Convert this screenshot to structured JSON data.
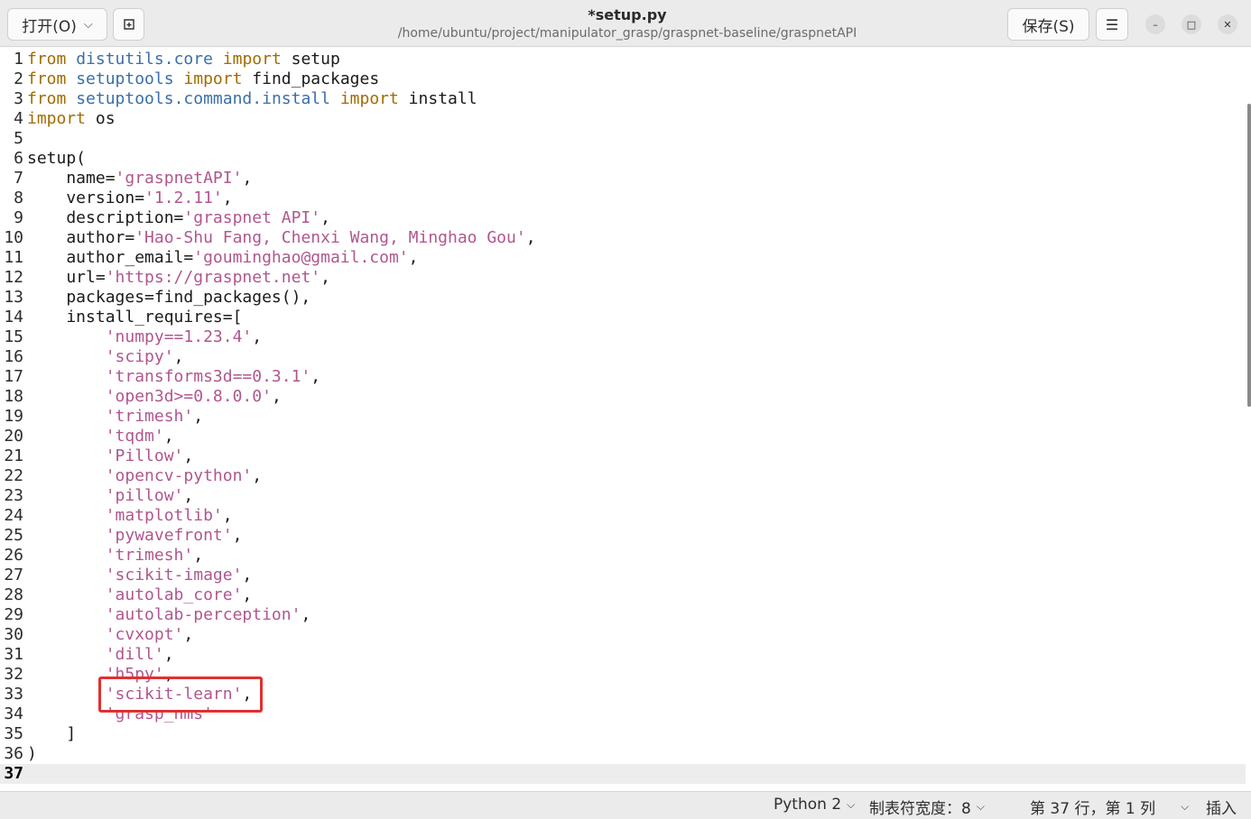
{
  "header": {
    "open_label": "打开(O)",
    "title": "*setup.py",
    "path": "/home/ubuntu/project/manipulator_grasp/graspnet-baseline/graspnetAPI",
    "save_label": "保存(S)"
  },
  "editor": {
    "current_line": 37,
    "lines": [
      {
        "n": "1",
        "tokens": [
          [
            "kw",
            "from"
          ],
          [
            "p",
            " "
          ],
          [
            "mod",
            "distutils.core"
          ],
          [
            "p",
            " "
          ],
          [
            "kw",
            "import"
          ],
          [
            "p",
            " setup"
          ]
        ]
      },
      {
        "n": "2",
        "tokens": [
          [
            "kw",
            "from"
          ],
          [
            "p",
            " "
          ],
          [
            "mod",
            "setuptools"
          ],
          [
            "p",
            " "
          ],
          [
            "kw",
            "import"
          ],
          [
            "p",
            " find_packages"
          ]
        ]
      },
      {
        "n": "3",
        "tokens": [
          [
            "kw",
            "from"
          ],
          [
            "p",
            " "
          ],
          [
            "mod",
            "setuptools.command.install"
          ],
          [
            "p",
            " "
          ],
          [
            "kw",
            "import"
          ],
          [
            "p",
            " install"
          ]
        ]
      },
      {
        "n": "4",
        "tokens": [
          [
            "kw",
            "import"
          ],
          [
            "p",
            " os"
          ]
        ]
      },
      {
        "n": "5",
        "tokens": []
      },
      {
        "n": "6",
        "tokens": [
          [
            "p",
            "setup("
          ]
        ]
      },
      {
        "n": "7",
        "tokens": [
          [
            "p",
            "    name="
          ],
          [
            "str",
            "'graspnetAPI'"
          ],
          [
            "p",
            ","
          ]
        ]
      },
      {
        "n": "8",
        "tokens": [
          [
            "p",
            "    version="
          ],
          [
            "str",
            "'1.2.11'"
          ],
          [
            "p",
            ","
          ]
        ]
      },
      {
        "n": "9",
        "tokens": [
          [
            "p",
            "    description="
          ],
          [
            "str",
            "'graspnet API'"
          ],
          [
            "p",
            ","
          ]
        ]
      },
      {
        "n": "10",
        "tokens": [
          [
            "p",
            "    author="
          ],
          [
            "str",
            "'Hao-Shu Fang, Chenxi Wang, Minghao Gou'"
          ],
          [
            "p",
            ","
          ]
        ]
      },
      {
        "n": "11",
        "tokens": [
          [
            "p",
            "    author_email="
          ],
          [
            "str",
            "'gouminghao@gmail.com'"
          ],
          [
            "p",
            ","
          ]
        ]
      },
      {
        "n": "12",
        "tokens": [
          [
            "p",
            "    url="
          ],
          [
            "str",
            "'https://graspnet.net'"
          ],
          [
            "p",
            ","
          ]
        ]
      },
      {
        "n": "13",
        "tokens": [
          [
            "p",
            "    packages=find_packages(),"
          ]
        ]
      },
      {
        "n": "14",
        "tokens": [
          [
            "p",
            "    install_requires=["
          ]
        ]
      },
      {
        "n": "15",
        "tokens": [
          [
            "p",
            "        "
          ],
          [
            "str",
            "'numpy==1.23.4'"
          ],
          [
            "p",
            ","
          ]
        ]
      },
      {
        "n": "16",
        "tokens": [
          [
            "p",
            "        "
          ],
          [
            "str",
            "'scipy'"
          ],
          [
            "p",
            ","
          ]
        ]
      },
      {
        "n": "17",
        "tokens": [
          [
            "p",
            "        "
          ],
          [
            "str",
            "'transforms3d==0.3.1'"
          ],
          [
            "p",
            ","
          ]
        ]
      },
      {
        "n": "18",
        "tokens": [
          [
            "p",
            "        "
          ],
          [
            "str",
            "'open3d>=0.8.0.0'"
          ],
          [
            "p",
            ","
          ]
        ]
      },
      {
        "n": "19",
        "tokens": [
          [
            "p",
            "        "
          ],
          [
            "str",
            "'trimesh'"
          ],
          [
            "p",
            ","
          ]
        ]
      },
      {
        "n": "20",
        "tokens": [
          [
            "p",
            "        "
          ],
          [
            "str",
            "'tqdm'"
          ],
          [
            "p",
            ","
          ]
        ]
      },
      {
        "n": "21",
        "tokens": [
          [
            "p",
            "        "
          ],
          [
            "str",
            "'Pillow'"
          ],
          [
            "p",
            ","
          ]
        ]
      },
      {
        "n": "22",
        "tokens": [
          [
            "p",
            "        "
          ],
          [
            "str",
            "'opencv-python'"
          ],
          [
            "p",
            ","
          ]
        ]
      },
      {
        "n": "23",
        "tokens": [
          [
            "p",
            "        "
          ],
          [
            "str",
            "'pillow'"
          ],
          [
            "p",
            ","
          ]
        ]
      },
      {
        "n": "24",
        "tokens": [
          [
            "p",
            "        "
          ],
          [
            "str",
            "'matplotlib'"
          ],
          [
            "p",
            ","
          ]
        ]
      },
      {
        "n": "25",
        "tokens": [
          [
            "p",
            "        "
          ],
          [
            "str",
            "'pywavefront'"
          ],
          [
            "p",
            ","
          ]
        ]
      },
      {
        "n": "26",
        "tokens": [
          [
            "p",
            "        "
          ],
          [
            "str",
            "'trimesh'"
          ],
          [
            "p",
            ","
          ]
        ]
      },
      {
        "n": "27",
        "tokens": [
          [
            "p",
            "        "
          ],
          [
            "str",
            "'scikit-image'"
          ],
          [
            "p",
            ","
          ]
        ]
      },
      {
        "n": "28",
        "tokens": [
          [
            "p",
            "        "
          ],
          [
            "str",
            "'autolab_core'"
          ],
          [
            "p",
            ","
          ]
        ]
      },
      {
        "n": "29",
        "tokens": [
          [
            "p",
            "        "
          ],
          [
            "str",
            "'autolab-perception'"
          ],
          [
            "p",
            ","
          ]
        ]
      },
      {
        "n": "30",
        "tokens": [
          [
            "p",
            "        "
          ],
          [
            "str",
            "'cvxopt'"
          ],
          [
            "p",
            ","
          ]
        ]
      },
      {
        "n": "31",
        "tokens": [
          [
            "p",
            "        "
          ],
          [
            "str",
            "'dill'"
          ],
          [
            "p",
            ","
          ]
        ]
      },
      {
        "n": "32",
        "tokens": [
          [
            "p",
            "        "
          ],
          [
            "str",
            "'h5py'"
          ],
          [
            "p",
            ","
          ]
        ]
      },
      {
        "n": "33",
        "tokens": [
          [
            "p",
            "        "
          ],
          [
            "str",
            "'scikit-learn'"
          ],
          [
            "p",
            ","
          ]
        ]
      },
      {
        "n": "34",
        "tokens": [
          [
            "p",
            "        "
          ],
          [
            "str",
            "'grasp_nms'"
          ]
        ]
      },
      {
        "n": "35",
        "tokens": [
          [
            "p",
            "    ]"
          ]
        ]
      },
      {
        "n": "36",
        "tokens": [
          [
            "p",
            ")"
          ]
        ]
      },
      {
        "n": "37",
        "tokens": []
      }
    ]
  },
  "status": {
    "language": "Python 2",
    "tab_width": "制表符宽度：8",
    "cursor": "第 37 行，第 1 列",
    "mode": "插入"
  },
  "colors": {
    "keyword": "#a26b00",
    "module": "#3b6ea8",
    "string": "#b0578f",
    "highlight_box": "#e22f2f"
  }
}
